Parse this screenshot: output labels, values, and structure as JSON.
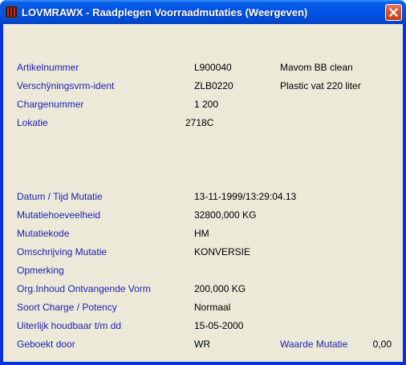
{
  "window": {
    "title": "LOVMRAWX - Raadplegen Voorraadmutaties (Weergeven)",
    "accent_color": "#0054e3",
    "close_color": "#d9502f",
    "label_color": "#1f1fb0",
    "background_color": "#ece9d8"
  },
  "icons": {
    "app": "app-icon",
    "close": "close-icon"
  },
  "fields": {
    "artikelnummer": {
      "label": "Artikelnummer",
      "value": "L900040",
      "description": "Mavom BB clean"
    },
    "verschijningsvorm": {
      "label": "Verschÿningsvrm-ident",
      "value": "ZLB0220",
      "description": "Plastic vat 220 liter"
    },
    "chargenummer": {
      "label": "Chargenummer",
      "value": "1 200"
    },
    "lokatie": {
      "label": "Lokatie",
      "value": "2718C"
    },
    "datum_tijd": {
      "label": "Datum / Tijd Mutatie",
      "value": "13-11-1999/13:29:04.13"
    },
    "hoeveelheid": {
      "label": "Mutatiehoeveelheid",
      "value": "32800,000 KG"
    },
    "mutatiekode": {
      "label": "Mutatiekode",
      "value": "HM"
    },
    "omschrijving": {
      "label": "Omschrijving Mutatie",
      "value": "KONVERSIE"
    },
    "opmerking": {
      "label": "Opmerking",
      "value": ""
    },
    "org_inhoud": {
      "label": "Org.Inhoud Ontvangende Vorm",
      "value": "200,000 KG"
    },
    "soort_charge": {
      "label": "Soort Charge / Potency",
      "value": "Normaal"
    },
    "houdbaar": {
      "label": "Uiterlijk houdbaar t/m dd",
      "value": "15-05-2000"
    },
    "geboekt_door": {
      "label": "Geboekt door",
      "value": "WR"
    },
    "waarde_mutatie": {
      "label": "Waarde Mutatie",
      "value": "0,00"
    }
  }
}
